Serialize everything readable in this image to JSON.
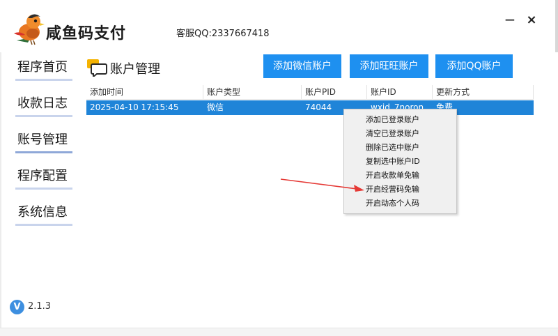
{
  "app": {
    "title": "咸鱼码支付",
    "support": "客服QQ:2337667418"
  },
  "window": {
    "minimize": "−",
    "close": "×"
  },
  "sidebar": {
    "items": [
      {
        "label": "程序首页",
        "active": false
      },
      {
        "label": "收款日志",
        "active": false
      },
      {
        "label": "账号管理",
        "active": true
      },
      {
        "label": "程序配置",
        "active": false
      },
      {
        "label": "系统信息",
        "active": false
      }
    ]
  },
  "page": {
    "title": "账户管理"
  },
  "buttons": {
    "add_wechat": "添加微信账户",
    "add_wangwang": "添加旺旺账户",
    "add_qq": "添加QQ账户"
  },
  "table": {
    "columns": [
      "添加时间",
      "账户类型",
      "账户PID",
      "账户ID",
      "更新方式"
    ],
    "rows": [
      {
        "time": "2025-04-10 17:15:45",
        "type": "微信",
        "pid": "74044",
        "id": "wxid_7noron",
        "mode": "免费"
      }
    ]
  },
  "context_menu": {
    "items": [
      "添加已登录账户",
      "清空已登录账户",
      "删除已选中账户",
      "复制选中账户ID",
      "开启收款单免输",
      "开启经营码免输",
      "开启动态个人码"
    ],
    "highlighted_index": 5
  },
  "version": {
    "icon": "V",
    "text": "2.1.3"
  },
  "colors": {
    "accent": "#1e90f0",
    "selection": "#1f84d8",
    "arrow": "#e53935"
  }
}
